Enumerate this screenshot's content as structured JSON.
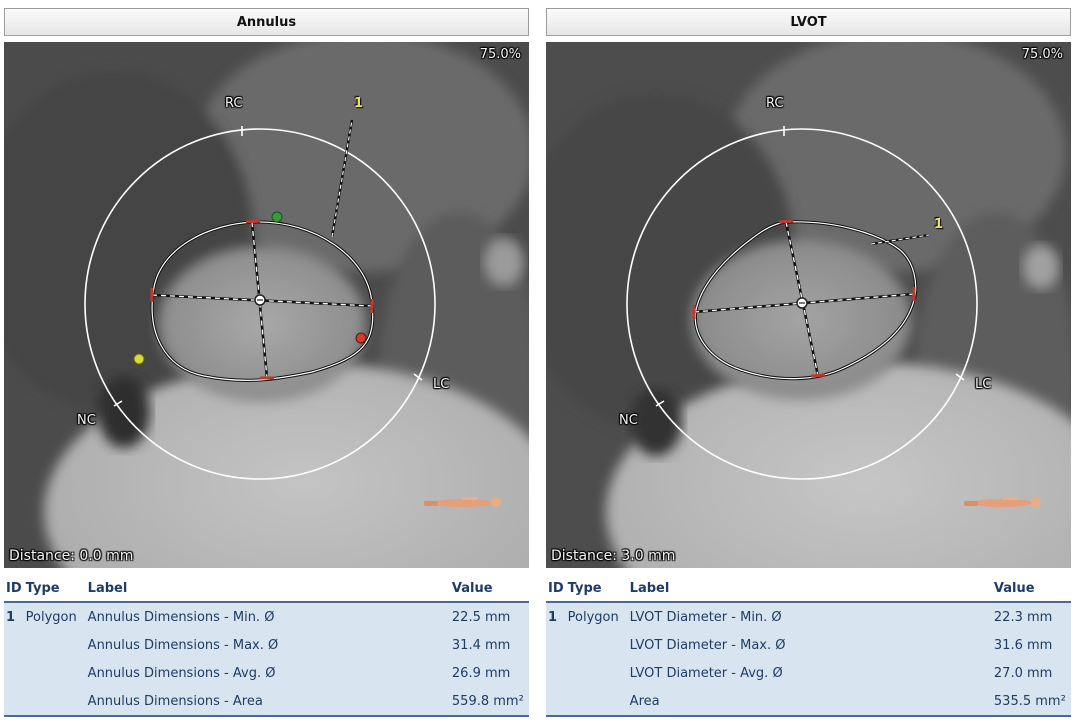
{
  "panels": [
    {
      "title": "Annulus",
      "zoom": "75.0%",
      "distance": "Distance: 0.0 mm",
      "cusp_labels": {
        "rc": "RC",
        "lc": "LC",
        "nc": "NC"
      },
      "marker_label": "1",
      "table": {
        "headers": {
          "id": "ID",
          "type": "Type",
          "label": "Label",
          "value": "Value"
        },
        "rows": [
          {
            "id": "1",
            "type": "Polygon",
            "label": "Annulus Dimensions - Min. Ø",
            "value": "22.5 mm"
          },
          {
            "id": "",
            "type": "",
            "label": "Annulus Dimensions - Max. Ø",
            "value": "31.4 mm"
          },
          {
            "id": "",
            "type": "",
            "label": "Annulus Dimensions - Avg. Ø",
            "value": "26.9 mm"
          },
          {
            "id": "",
            "type": "",
            "label": "Annulus Dimensions - Area",
            "value": "559.8 mm²"
          }
        ]
      }
    },
    {
      "title": "LVOT",
      "zoom": "75.0%",
      "distance": "Distance: 3.0 mm",
      "cusp_labels": {
        "rc": "RC",
        "lc": "LC",
        "nc": "NC"
      },
      "marker_label": "1",
      "table": {
        "headers": {
          "id": "ID",
          "type": "Type",
          "label": "Label",
          "value": "Value"
        },
        "rows": [
          {
            "id": "1",
            "type": "Polygon",
            "label": "LVOT Diameter - Min. Ø",
            "value": "22.3 mm"
          },
          {
            "id": "",
            "type": "",
            "label": "LVOT Diameter - Max. Ø",
            "value": "31.6 mm"
          },
          {
            "id": "",
            "type": "",
            "label": "LVOT Diameter - Avg. Ø",
            "value": "27.0 mm"
          },
          {
            "id": "",
            "type": "",
            "label": "Area",
            "value": "535.5 mm²"
          }
        ]
      }
    }
  ],
  "colors": {
    "table_row_bg": "#d9e4f1",
    "table_text": "#1f3c63",
    "marker_yellow": "#e7e35a",
    "caliper_red": "#c0392b",
    "point_green": "#3a9a3a",
    "point_yellow": "#d8d83a",
    "point_red": "#d23c2c"
  }
}
